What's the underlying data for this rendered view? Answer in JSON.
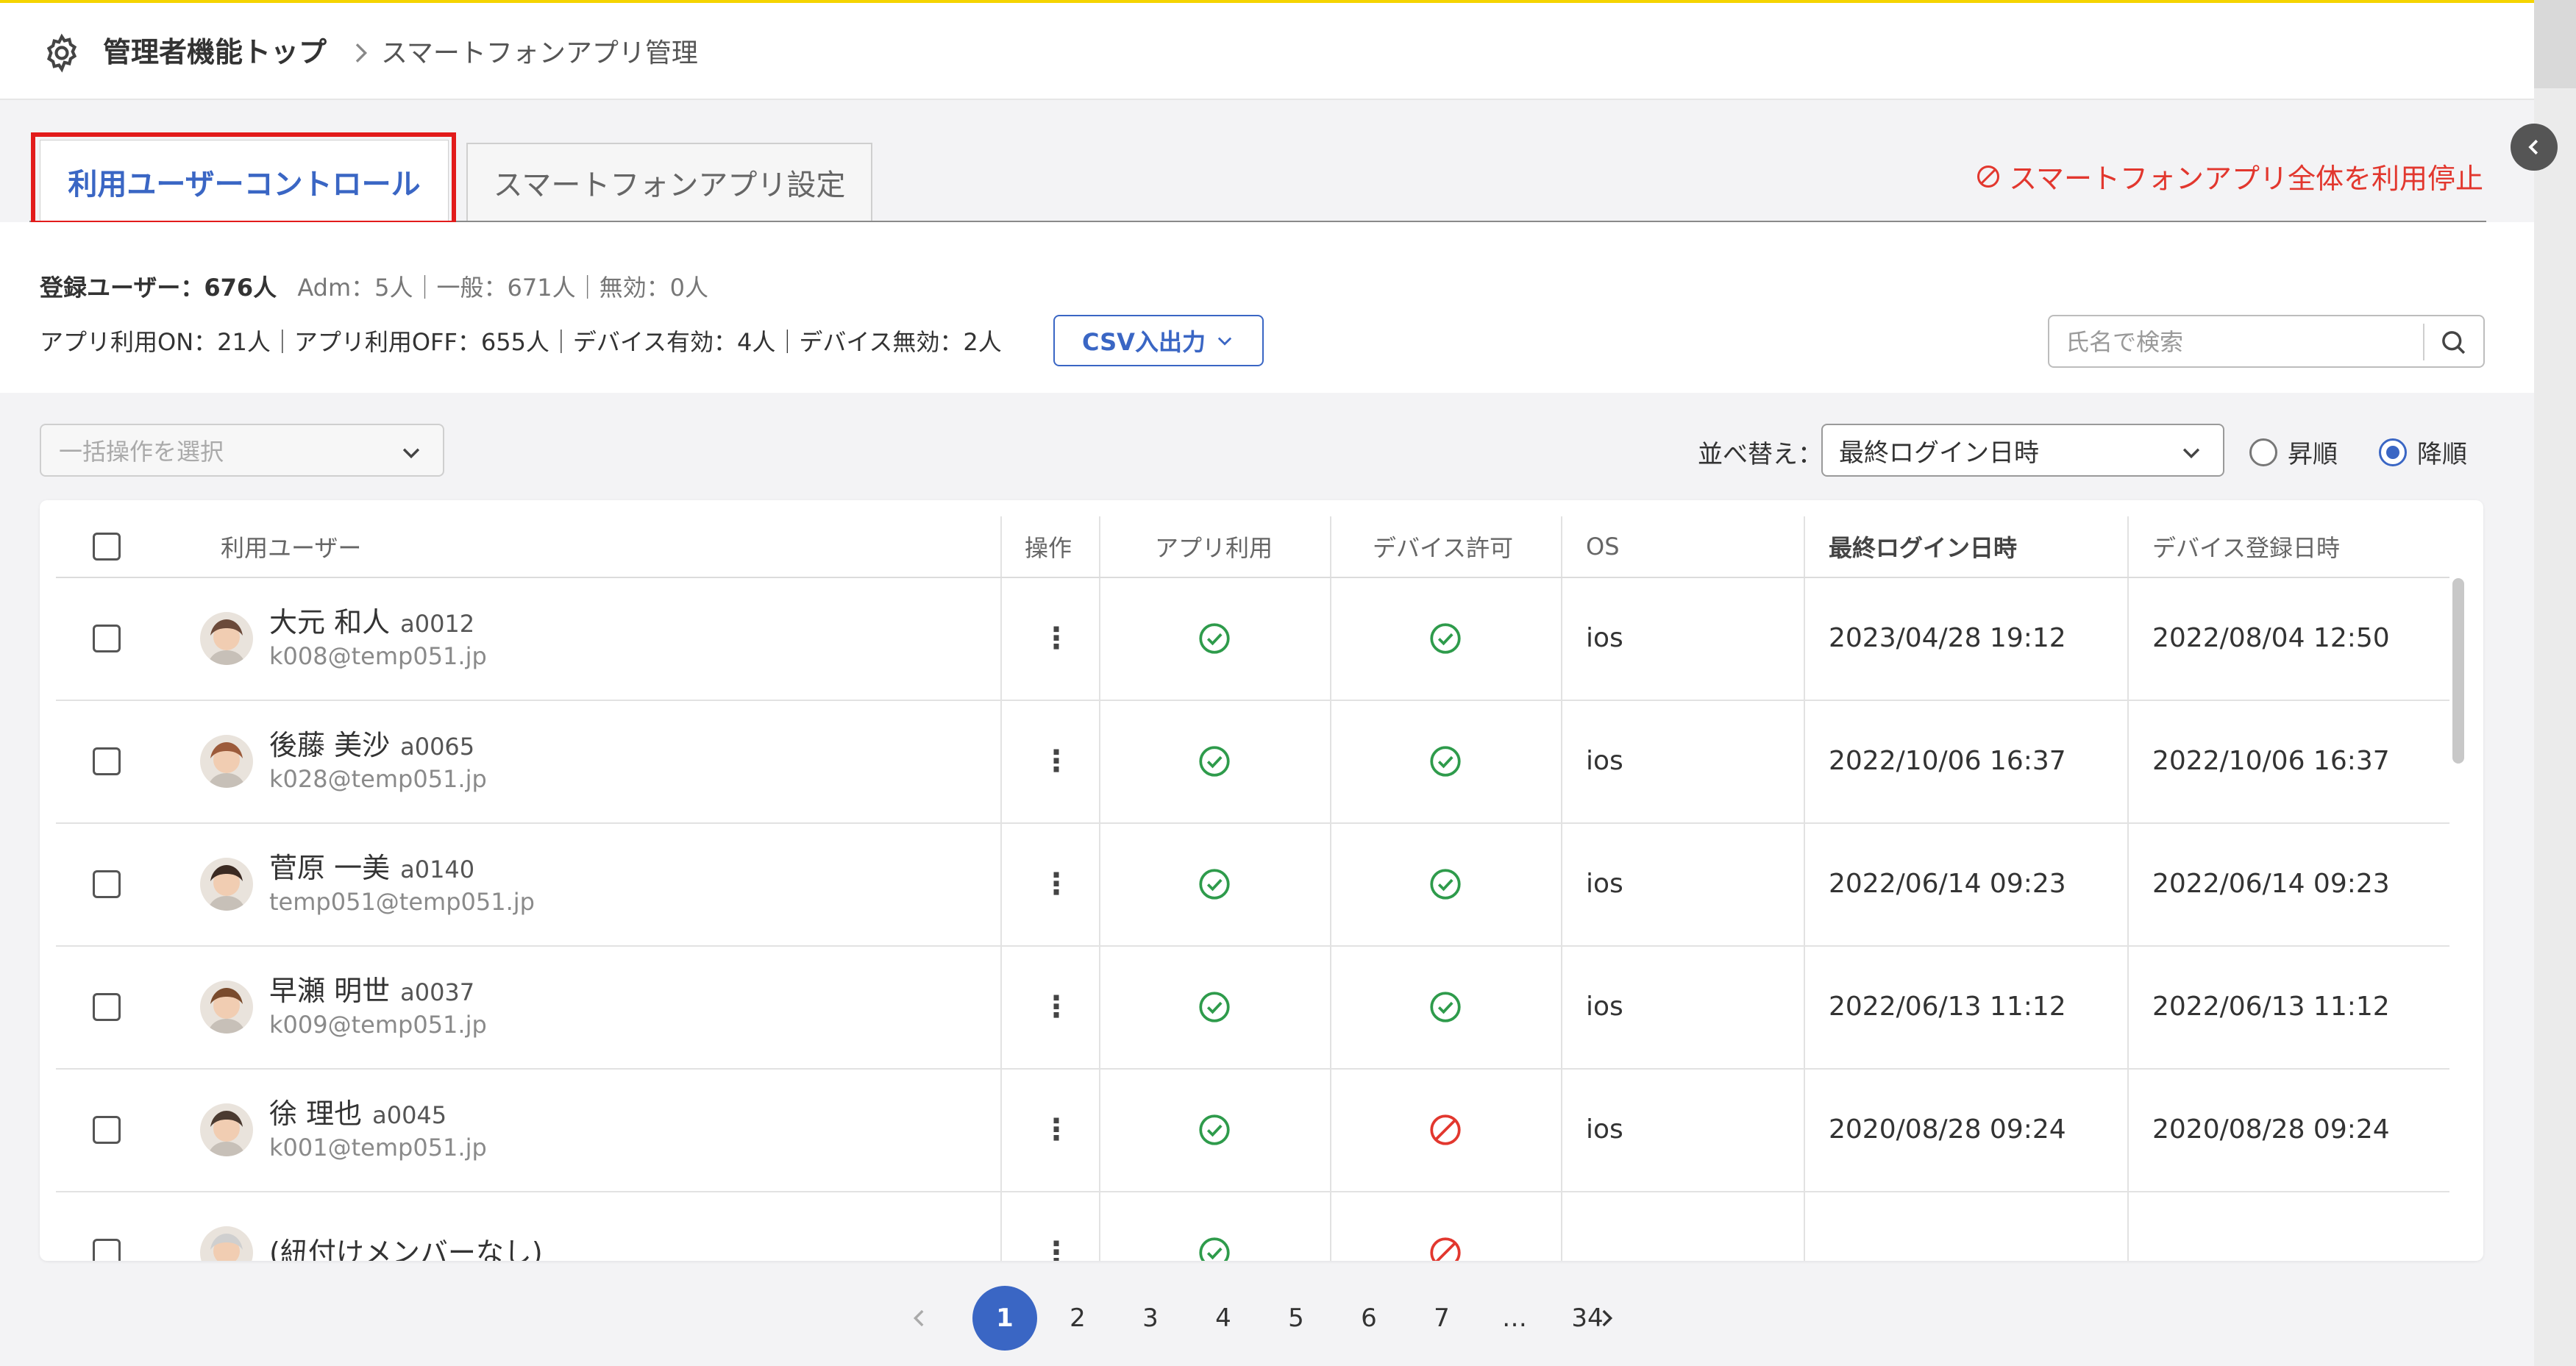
{
  "breadcrumb": {
    "root": "管理者機能トップ",
    "current": "スマートフォンアプリ管理"
  },
  "tabs": [
    {
      "label": "利用ユーザーコントロール",
      "active": true
    },
    {
      "label": "スマートフォンアプリ設定",
      "active": false
    }
  ],
  "stop_all_label": "スマートフォンアプリ全体を利用停止",
  "stats": {
    "registered": "登録ユーザー：676人",
    "breakdown": "Adm：5人｜一般：671人｜無効：0人",
    "line2": "アプリ利用ON：21人｜アプリ利用OFF：655人｜デバイス有効：4人｜デバイス無効：2人"
  },
  "csv_button": "CSV入出力",
  "search": {
    "placeholder": "氏名で検索",
    "value": ""
  },
  "bulk": {
    "placeholder": "一括操作を選択"
  },
  "sort": {
    "label": "並べ替え：",
    "selected": "最終ログイン日時",
    "asc": "昇順",
    "desc": "降順",
    "order": "desc"
  },
  "table": {
    "headers": {
      "user": "利用ユーザー",
      "action": "操作",
      "app": "アプリ利用",
      "device": "デバイス許可",
      "os": "OS",
      "last_login": "最終ログイン日時",
      "device_reg": "デバイス登録日時"
    },
    "rows": [
      {
        "name": "大元 和人",
        "code": "a0012",
        "email": "k008@temp051.jp",
        "app": "ok",
        "device": "ok",
        "os": "ios",
        "last_login": "2023/04/28 19:12",
        "device_reg": "2022/08/04 12:50",
        "avatar_color": "#6b4a3a"
      },
      {
        "name": "後藤 美沙",
        "code": "a0065",
        "email": "k028@temp051.jp",
        "app": "ok",
        "device": "ok",
        "os": "ios",
        "last_login": "2022/10/06 16:37",
        "device_reg": "2022/10/06 16:37",
        "avatar_color": "#9c5b3b"
      },
      {
        "name": "菅原 一美",
        "code": "a0140",
        "email": "temp051@temp051.jp",
        "app": "ok",
        "device": "ok",
        "os": "ios",
        "last_login": "2022/06/14 09:23",
        "device_reg": "2022/06/14 09:23",
        "avatar_color": "#3b2a22"
      },
      {
        "name": "早瀬 明世",
        "code": "a0037",
        "email": "k009@temp051.jp",
        "app": "ok",
        "device": "ok",
        "os": "ios",
        "last_login": "2022/06/13 11:12",
        "device_reg": "2022/06/13 11:12",
        "avatar_color": "#7a4b2d"
      },
      {
        "name": "徐 理也",
        "code": "a0045",
        "email": "k001@temp051.jp",
        "app": "ok",
        "device": "blocked",
        "os": "ios",
        "last_login": "2020/08/28 09:24",
        "device_reg": "2020/08/28 09:24",
        "avatar_color": "#4a3a30"
      },
      {
        "name": "(紐付けメンバーなし)",
        "code": "",
        "email": "",
        "app": "ok",
        "device": "blocked",
        "os": "",
        "last_login": "",
        "device_reg": "",
        "avatar_color": "#cfcfcf"
      }
    ]
  },
  "pagination": {
    "pages": [
      "1",
      "2",
      "3",
      "4",
      "5",
      "6",
      "7",
      "…",
      "34"
    ],
    "current": "1"
  },
  "colors": {
    "accent": "#3a66c4",
    "ok": "#2e9b4b",
    "blocked": "#e2372e",
    "highlight": "#e21b1b"
  },
  "icons": {
    "gear": "gear-icon",
    "chevron_right": "chevron-right-icon",
    "search": "search-icon",
    "ok": "check-circle-icon",
    "blocked": "prohibited-icon"
  }
}
